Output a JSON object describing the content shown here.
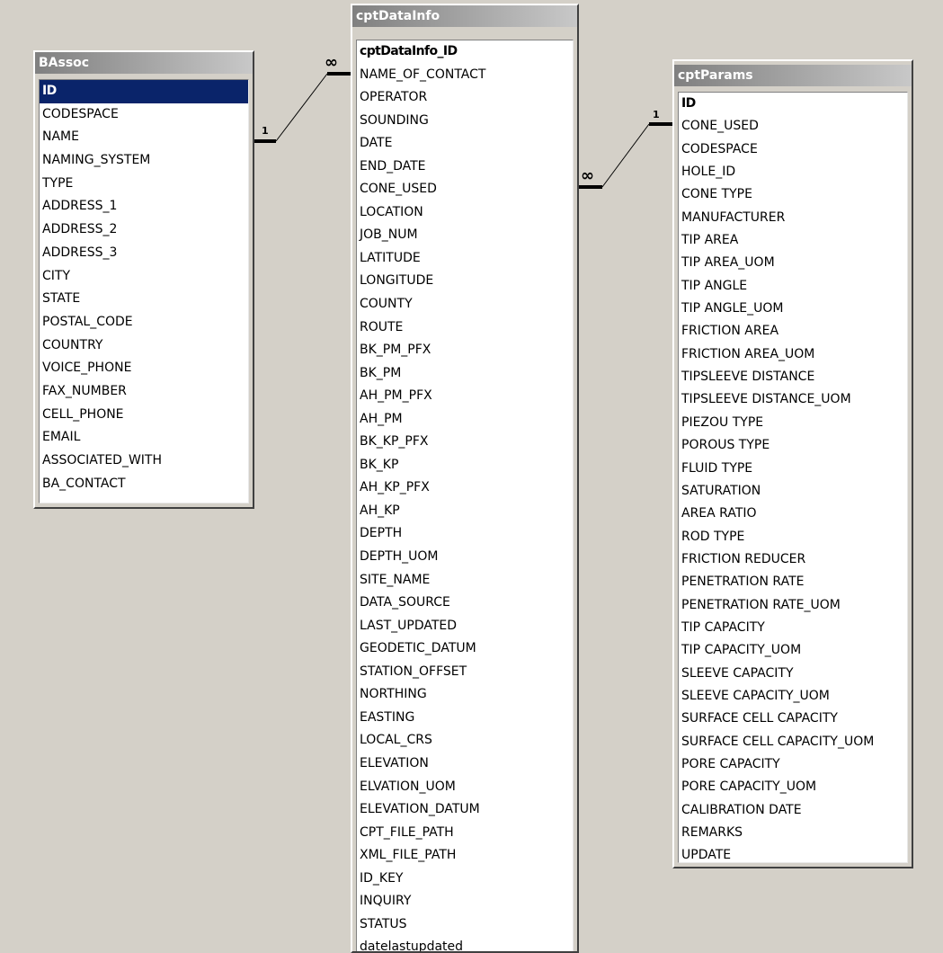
{
  "tables": {
    "bassoc": {
      "title": "BAssoc",
      "fields": [
        "ID",
        "CODESPACE",
        "NAME",
        "NAMING_SYSTEM",
        "TYPE",
        "ADDRESS_1",
        "ADDRESS_2",
        "ADDRESS_3",
        "CITY",
        "STATE",
        "POSTAL_CODE",
        "COUNTRY",
        "VOICE_PHONE",
        "FAX_NUMBER",
        "CELL_PHONE",
        "EMAIL",
        "ASSOCIATED_WITH",
        "BA_CONTACT"
      ]
    },
    "cptdatainfo": {
      "title": "cptDataInfo",
      "fields": [
        "cptDataInfo_ID",
        "NAME_OF_CONTACT",
        "OPERATOR",
        "SOUNDING",
        "DATE",
        "END_DATE",
        "CONE_USED",
        "LOCATION",
        "JOB_NUM",
        "LATITUDE",
        "LONGITUDE",
        "COUNTY",
        "ROUTE",
        "BK_PM_PFX",
        "BK_PM",
        "AH_PM_PFX",
        "AH_PM",
        "BK_KP_PFX",
        "BK_KP",
        "AH_KP_PFX",
        "AH_KP",
        "DEPTH",
        "DEPTH_UOM",
        "SITE_NAME",
        "DATA_SOURCE",
        "LAST_UPDATED",
        "GEODETIC_DATUM",
        "STATION_OFFSET",
        "NORTHING",
        "EASTING",
        "LOCAL_CRS",
        "ELEVATION",
        "ELVATION_UOM",
        "ELEVATION_DATUM",
        "CPT_FILE_PATH",
        "XML_FILE_PATH",
        "ID_KEY",
        "INQUIRY",
        "STATUS",
        "datelastupdated"
      ]
    },
    "cptparams": {
      "title": "cptParams",
      "fields": [
        "ID",
        "CONE_USED",
        "CODESPACE",
        "HOLE_ID",
        "CONE TYPE",
        "MANUFACTURER",
        "TIP AREA",
        "TIP AREA_UOM",
        "TIP ANGLE",
        "TIP ANGLE_UOM",
        "FRICTION AREA",
        "FRICTION AREA_UOM",
        "TIPSLEEVE DISTANCE",
        "TIPSLEEVE DISTANCE_UOM",
        "PIEZOU TYPE",
        "POROUS TYPE",
        "FLUID TYPE",
        "SATURATION",
        "AREA RATIO",
        "ROD TYPE",
        "FRICTION REDUCER",
        "PENETRATION RATE",
        "PENETRATION RATE_UOM",
        "TIP CAPACITY",
        "TIP CAPACITY_UOM",
        "SLEEVE CAPACITY",
        "SLEEVE CAPACITY_UOM",
        "SURFACE CELL CAPACITY",
        "SURFACE CELL CAPACITY_UOM",
        "PORE CAPACITY",
        "PORE CAPACITY_UOM",
        "CALIBRATION DATE",
        "REMARKS",
        "UPDATE"
      ]
    }
  },
  "relationships": {
    "bassoc_to_cptdatainfo": {
      "one_label": "1",
      "many_label": "∞"
    },
    "cptparams_to_cptdatainfo": {
      "one_label": "1",
      "many_label": "∞"
    }
  }
}
